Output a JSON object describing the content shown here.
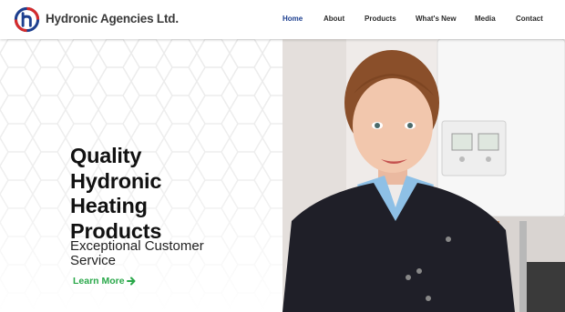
{
  "brand": {
    "name": "Hydronic Agencies Ltd.",
    "logo_letter": "h",
    "logo_colors": {
      "blue": "#1d3f8f",
      "red": "#d62b2b"
    }
  },
  "nav": {
    "items": [
      {
        "label": "Home",
        "active": true
      },
      {
        "label": "About",
        "active": false
      },
      {
        "label": "Products",
        "active": false
      },
      {
        "label": "What's New",
        "active": false
      },
      {
        "label": "Media",
        "active": false
      },
      {
        "label": "Contact",
        "active": false
      }
    ]
  },
  "hero": {
    "headline_lines": [
      "Quality",
      "Hydronic",
      "Heating",
      "Products"
    ],
    "subtitle_lines": [
      "Exceptional Customer",
      "Service"
    ],
    "cta_label": "Learn More",
    "cta_icon": "arrow-right-icon"
  },
  "colors": {
    "accent_green": "#2aa84a",
    "nav_active": "#1d3f8f",
    "text_dark": "#111111"
  }
}
